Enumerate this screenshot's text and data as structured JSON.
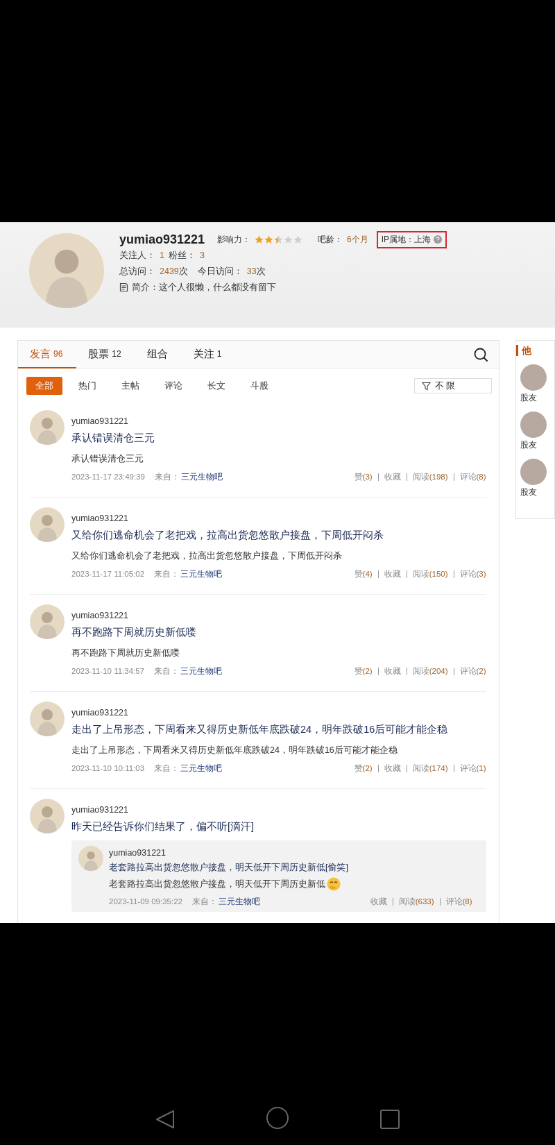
{
  "profile": {
    "username": "yumiao931221",
    "influence": {
      "label": "影响力：",
      "stars": 2.5
    },
    "bar_age": {
      "label": "吧龄：",
      "value": "6个月"
    },
    "ip": {
      "label": "IP属地：上海",
      "highlighted": true
    },
    "stats": [
      {
        "label": "关注人：",
        "value": "1"
      },
      {
        "label": "粉丝：",
        "value": "3"
      }
    ],
    "visits": [
      {
        "label": "总访问：",
        "value": "2439",
        "unit": "次"
      },
      {
        "label": "今日访问：",
        "value": "33",
        "unit": "次"
      }
    ],
    "intro": "简介：这个人很懒，什么都没有留下"
  },
  "tabs": [
    {
      "label": "发言",
      "count": "96",
      "selected": true
    },
    {
      "label": "股票",
      "count": "12",
      "selected": false
    },
    {
      "label": "组合",
      "selected": false
    },
    {
      "label": "关注",
      "count": "1",
      "selected": false
    }
  ],
  "filters": [
    {
      "label": "全部",
      "selected": true
    },
    {
      "label": "热门",
      "selected": false
    },
    {
      "label": "主帖",
      "selected": false
    },
    {
      "label": "评论",
      "selected": false
    },
    {
      "label": "长文",
      "selected": false
    },
    {
      "label": "斗股",
      "selected": false
    }
  ],
  "range_filter": "不 限",
  "posts": [
    {
      "author": "yumiao931221",
      "title": "承认错误清仓三元",
      "body": "承认错误清仓三元",
      "time": "2023-11-17 23:49:39",
      "source_label": "来自：",
      "source": "三元生物吧",
      "actions": [
        {
          "label": "赞",
          "count": "(3)"
        },
        {
          "label": "收藏"
        },
        {
          "label": "阅读",
          "count": "(198)"
        },
        {
          "label": "评论",
          "count": "(8)"
        }
      ]
    },
    {
      "author": "yumiao931221",
      "title": "又给你们逃命机会了老把戏，拉高出货忽悠散户接盘，下周低开闷杀",
      "body": "又给你们逃命机会了老把戏，拉高出货忽悠散户接盘，下周低开闷杀",
      "time": "2023-11-17 11:05:02",
      "source_label": "来自：",
      "source": "三元生物吧",
      "actions": [
        {
          "label": "赞",
          "count": "(4)"
        },
        {
          "label": "收藏"
        },
        {
          "label": "阅读",
          "count": "(150)"
        },
        {
          "label": "评论",
          "count": "(3)"
        }
      ]
    },
    {
      "author": "yumiao931221",
      "title": "再不跑路下周就历史新低喽",
      "body": "再不跑路下周就历史新低喽",
      "time": "2023-11-10 11:34:57",
      "source_label": "来自：",
      "source": "三元生物吧",
      "actions": [
        {
          "label": "赞",
          "count": "(2)"
        },
        {
          "label": "收藏"
        },
        {
          "label": "阅读",
          "count": "(204)"
        },
        {
          "label": "评论",
          "count": "(2)"
        }
      ]
    },
    {
      "author": "yumiao931221",
      "title": "走出了上吊形态，下周看来又得历史新低年底跌破24，明年跌破16后可能才能企稳",
      "body": "走出了上吊形态，下周看来又得历史新低年底跌破24，明年跌破16后可能才能企稳",
      "time": "2023-11-10 10:11:03",
      "source_label": "来自：",
      "source": "三元生物吧",
      "actions": [
        {
          "label": "赞",
          "count": "(2)"
        },
        {
          "label": "收藏"
        },
        {
          "label": "阅读",
          "count": "(174)"
        },
        {
          "label": "评论",
          "count": "(1)"
        }
      ]
    },
    {
      "author": "yumiao931221",
      "title": "昨天已经告诉你们结果了，偏不听[滴汗]",
      "repost": {
        "author": "yumiao931221",
        "title": "老套路拉高出货忽悠散户接盘，明天低开下周历史新低[偷笑]",
        "body": "老套路拉高出货忽悠散户接盘，明天低开下周历史新低",
        "body_emoji": true,
        "time": "2023-11-09 09:35:22",
        "source_label": "来自：",
        "source": "三元生物吧",
        "actions": [
          {
            "label": "收藏"
          },
          {
            "label": "阅读",
            "count": "(633)"
          },
          {
            "label": "评论",
            "count": "(8)"
          }
        ]
      }
    }
  ],
  "side_panel": {
    "title": "他",
    "items": [
      {
        "label": "股友"
      },
      {
        "label": "股友"
      },
      {
        "label": "股友"
      }
    ]
  }
}
